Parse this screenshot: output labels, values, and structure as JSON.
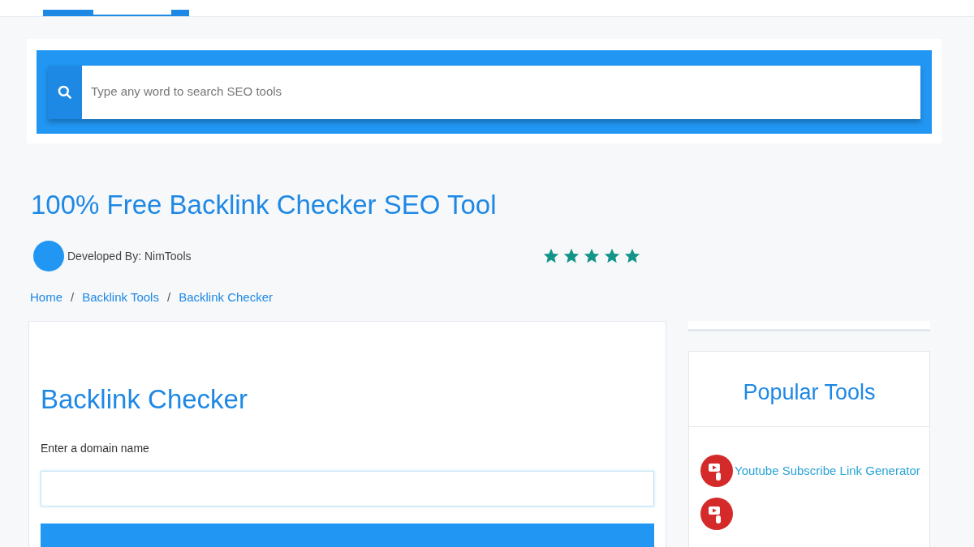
{
  "search": {
    "placeholder": "Type any word to search SEO tools"
  },
  "title": "100% Free Backlink Checker SEO Tool",
  "developer": "Developed By: NimTools",
  "rating": {
    "stars": 5
  },
  "breadcrumb": [
    {
      "label": "Home"
    },
    {
      "separator": "/",
      "label": "Backlink Tools"
    },
    {
      "separator": "/",
      "label": "Backlink Checker"
    }
  ],
  "tool": {
    "heading": "Backlink Checker",
    "field_label": "Enter a domain name"
  },
  "sidebar": {
    "heading": "Popular Tools",
    "items": [
      {
        "kind": "link",
        "label": "Youtube Subscribe Link Generator"
      },
      {
        "kind": "icon"
      }
    ]
  }
}
